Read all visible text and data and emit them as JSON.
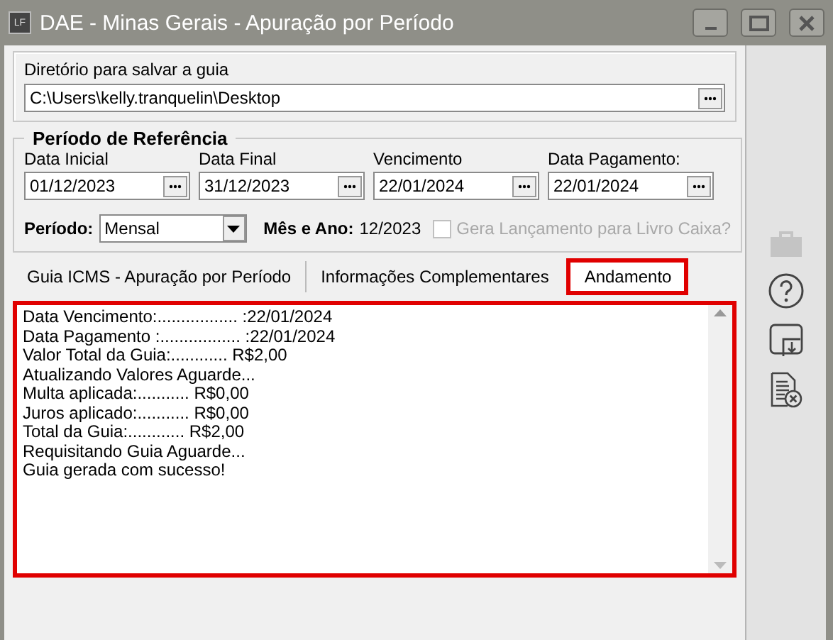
{
  "window": {
    "app_badge": "LF",
    "title": "DAE - Minas Gerais - Apuração por Período"
  },
  "directory": {
    "label": "Diretório para salvar a guia",
    "value": "C:\\Users\\kelly.tranquelin\\Desktop"
  },
  "period": {
    "legend": "Período de Referência",
    "dates": [
      {
        "label": "Data Inicial",
        "value": "01/12/2023"
      },
      {
        "label": "Data Final",
        "value": "31/12/2023"
      },
      {
        "label": "Vencimento",
        "value": "22/01/2024"
      },
      {
        "label": "Data Pagamento:",
        "value": "22/01/2024"
      }
    ],
    "period_label": "Período:",
    "period_value": "Mensal",
    "month_label": "Mês e Ano:",
    "month_value": "12/2023",
    "cash_book": {
      "label": "Gera Lançamento para Livro Caixa?",
      "checked": false,
      "disabled": true
    }
  },
  "tabs": [
    {
      "label": "Guia ICMS - Apuração por Período",
      "selected": false,
      "highlighted": false
    },
    {
      "label": "Informações Complementares",
      "selected": false,
      "highlighted": false
    },
    {
      "label": "Andamento",
      "selected": true,
      "highlighted": true
    }
  ],
  "log": {
    "highlighted": true,
    "lines": [
      "Data Vencimento:................. :22/01/2024",
      "Data Pagamento :................. :22/01/2024",
      "Valor Total da Guia:............ R$2,00",
      "Atualizando Valores Aguarde...",
      "Multa aplicada:........... R$0,00",
      "Juros aplicado:........... R$0,00",
      "Total da Guia:............ R$2,00",
      "Requisitando Guia Aguarde...",
      "Guia gerada com sucesso!"
    ]
  },
  "toolbar": [
    {
      "kind": "briefcase",
      "disabled": true
    },
    {
      "kind": "help",
      "disabled": false
    },
    {
      "kind": "download",
      "disabled": false
    },
    {
      "kind": "cancel",
      "disabled": false
    }
  ]
}
